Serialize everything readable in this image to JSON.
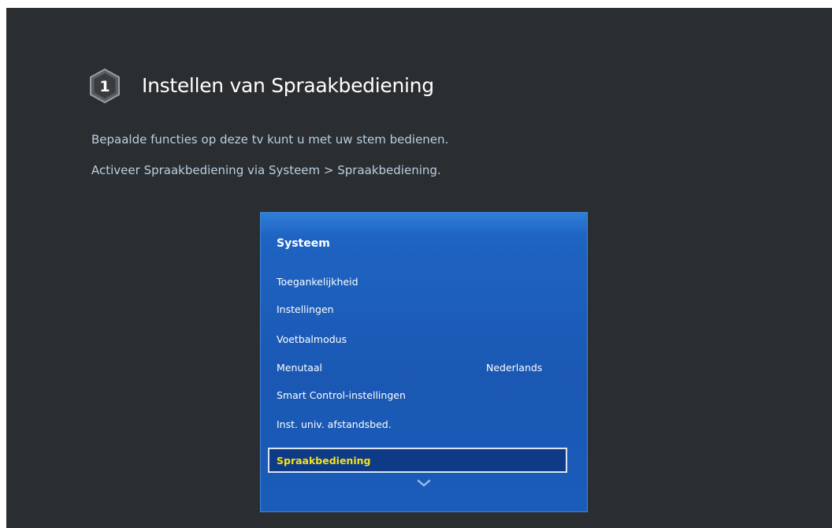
{
  "step": {
    "number": "1",
    "title": "Instellen van Spraakbediening",
    "description_line1": "Bepaalde functies op deze tv kunt u met uw stem bedienen.",
    "description_line2": "Activeer Spraakbediening via Systeem > Spraakbediening."
  },
  "menu": {
    "title": "Systeem",
    "items": [
      {
        "label": "Toegankelijkheid",
        "value": ""
      },
      {
        "label": "Instellingen",
        "value": ""
      },
      {
        "label": "Voetbalmodus",
        "value": ""
      },
      {
        "label": "Menutaal",
        "value": "Nederlands"
      },
      {
        "label": "Smart Control-instellingen",
        "value": ""
      },
      {
        "label": "Inst. univ. afstandsbed.",
        "value": ""
      },
      {
        "label": "Spraakbediening",
        "value": "",
        "selected": true
      }
    ],
    "scroll_icon": "chevron-down-icon"
  },
  "colors": {
    "background": "#2b2e31",
    "panel": "#1a58b3",
    "selected_bg": "#0f3a86",
    "selected_text": "#f2e21c",
    "description_text": "#b9cfe2"
  }
}
